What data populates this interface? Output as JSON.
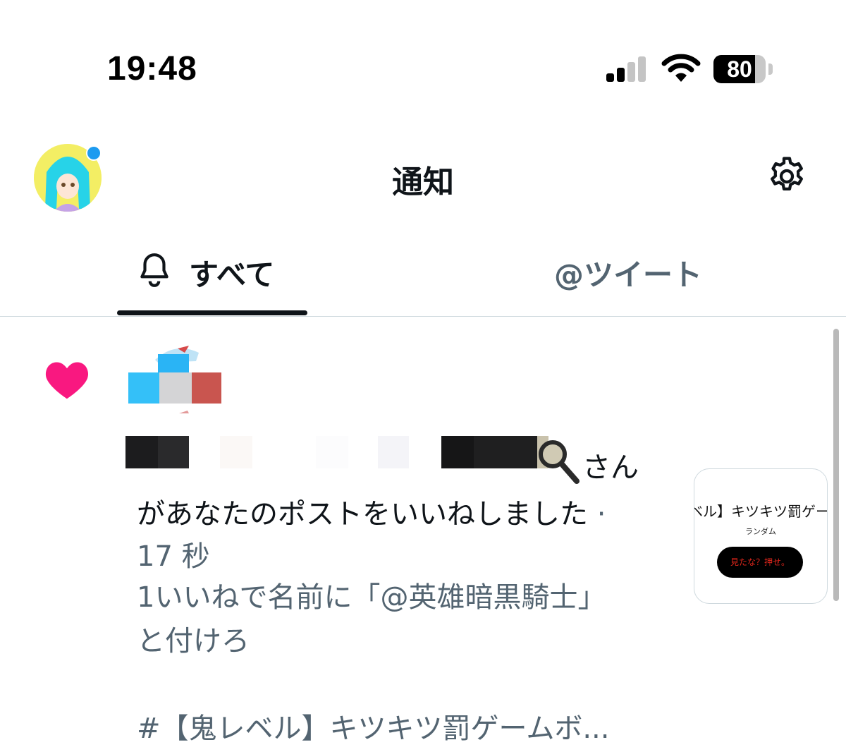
{
  "status_bar": {
    "time": "19:48",
    "battery_level": "80",
    "battery_fraction": 0.8,
    "signal_icon": "cellular-signal-icon",
    "wifi_icon": "wifi-icon"
  },
  "header": {
    "title": "通知",
    "settings_icon": "gear-icon"
  },
  "tabs": [
    {
      "label": "すべて",
      "icon": "bell-icon",
      "selected": true
    },
    {
      "label": "@ツイート",
      "selected": false
    }
  ],
  "notification": {
    "icon": "heart-icon",
    "suffix": "さん",
    "action": "があなたのポストをいいねしました",
    "separator": "·",
    "time": "17 秒",
    "post_lines": [
      "1いいねで名前に「@英雄暗黒騎士」",
      "と付けろ",
      "",
      "#【鬼レベル】キツキツ罰ゲームボ..."
    ],
    "thumbnail": {
      "title": "ベル】キツキツ罰ゲーム",
      "subtitle": "ランダム",
      "button": "見たな？押せ。"
    }
  },
  "colors": {
    "heart": "#f91880",
    "accent": "#1d9bf0",
    "text": "#0f1419",
    "secondary": "#536471"
  }
}
